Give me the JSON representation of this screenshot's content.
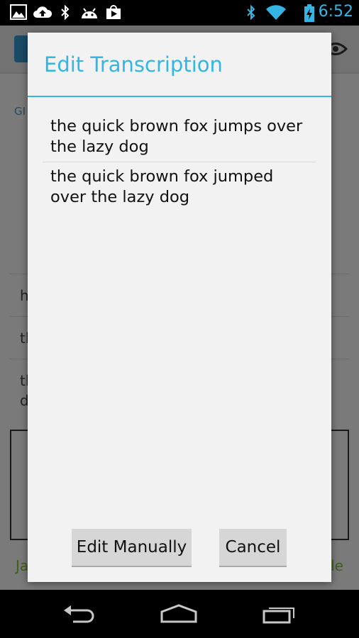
{
  "status_bar": {
    "time": "6:52",
    "icons": [
      "gallery-icon",
      "cloud-upload-icon",
      "bluetooth-icon",
      "android-icon",
      "play-store-icon",
      "bluetooth-icon",
      "wifi-icon",
      "battery-charging-icon"
    ]
  },
  "background": {
    "section_label": "GI",
    "rows": [
      "h",
      "th",
      "th\nd"
    ],
    "footer_left": "Ja",
    "footer_right": "le"
  },
  "dialog": {
    "title": "Edit Transcription",
    "transcriptions": [
      "the quick brown fox jumps over the lazy dog",
      "the quick brown fox jumped over the lazy dog"
    ],
    "edit_manually_label": "Edit Manually",
    "cancel_label": "Cancel"
  },
  "navigation": {
    "icons": [
      "back-icon",
      "home-icon",
      "recents-icon"
    ]
  },
  "colors": {
    "accent": "#33b5e5",
    "dialog_bg": "#f2f2f2",
    "button_bg": "#d6d6d6"
  }
}
